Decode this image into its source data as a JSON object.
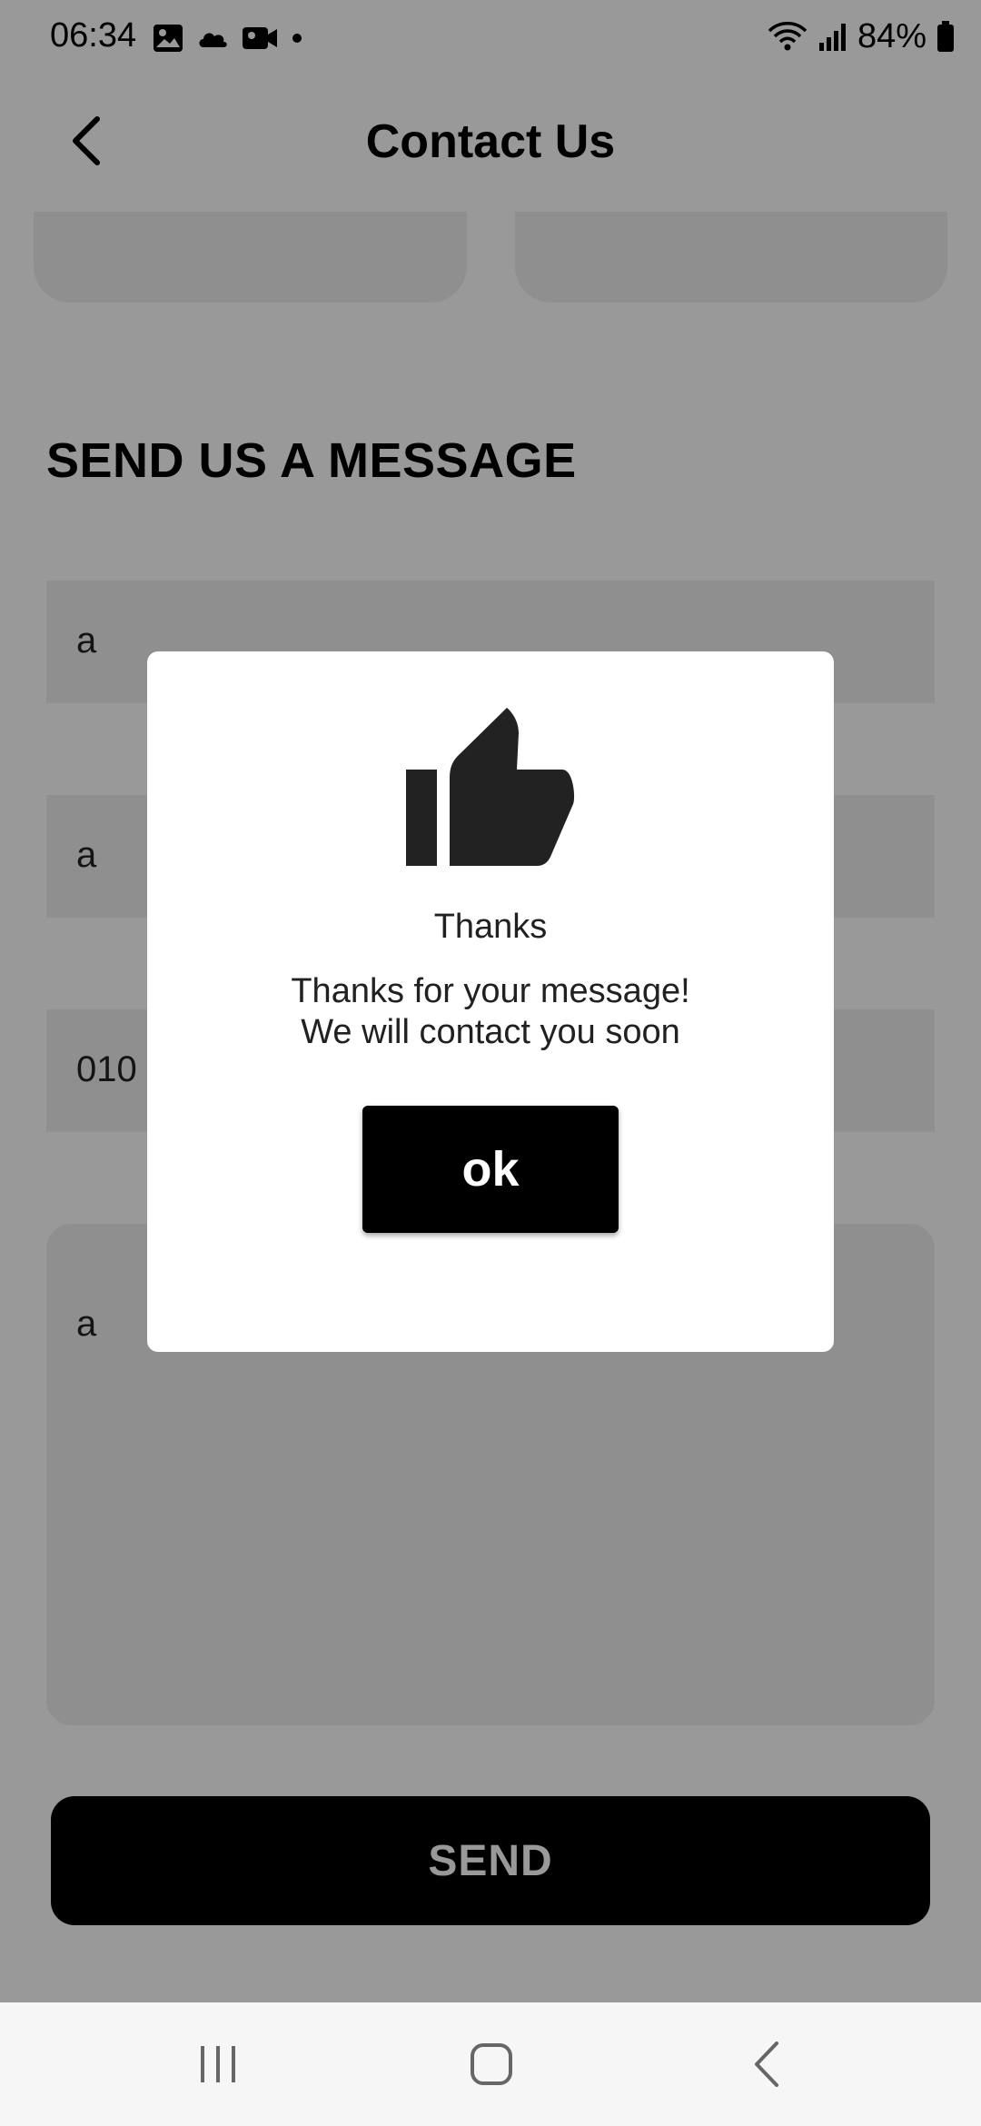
{
  "status_bar": {
    "time": "06:34",
    "battery": "84%",
    "left_icons": [
      "gallery-icon",
      "cloud-icon",
      "video-icon",
      "dot-icon"
    ],
    "right_icons": [
      "wifi-icon",
      "signal-icon",
      "battery-icon"
    ]
  },
  "header": {
    "title": "Contact Us",
    "back_icon": "chevron-left-icon"
  },
  "section": {
    "title": "SEND US A MESSAGE"
  },
  "form": {
    "field1_value": "a",
    "field2_value": "a",
    "field3_value": "010",
    "message_value": "a",
    "send_label": "SEND"
  },
  "dialog": {
    "icon": "thumbs-up-icon",
    "title": "Thanks",
    "message_line1": "Thanks for your message!",
    "message_line2": "We will contact you soon",
    "ok_label": "ok"
  },
  "nav": {
    "recents_icon": "recents-icon",
    "home_icon": "home-icon",
    "back_icon": "back-icon"
  },
  "colors": {
    "scrim": "#000000",
    "button_bg": "#000000",
    "field_bg": "#eeeeee",
    "dialog_bg": "#ffffff"
  }
}
